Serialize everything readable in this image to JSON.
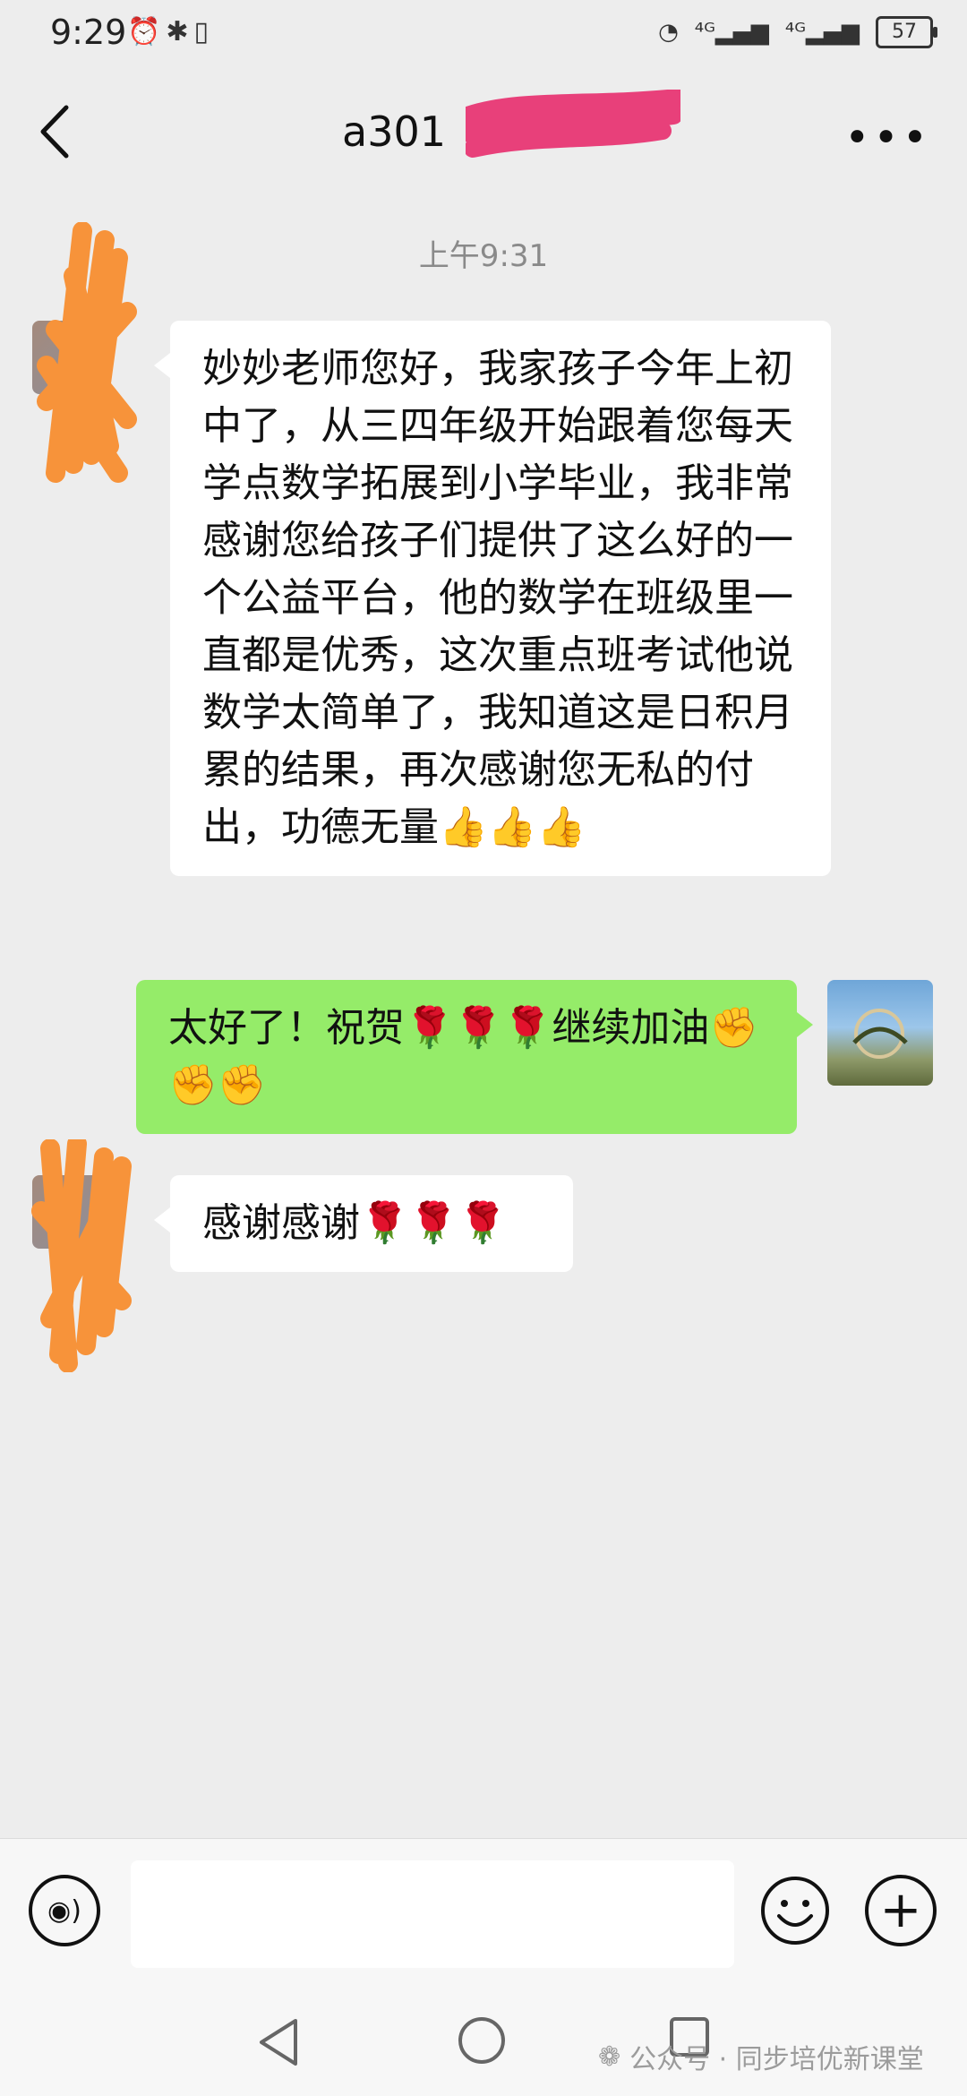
{
  "status_bar": {
    "time": "9:29",
    "left_icons": [
      "alarm-icon",
      "bluetooth-icon",
      "vibrate-icon"
    ],
    "signal_1": "⁴ᴳ",
    "signal_2": "⁴ᴳ",
    "battery": "57"
  },
  "header": {
    "title": "a301",
    "back": "back-icon",
    "more": "•••"
  },
  "timestamp": "上午9:31",
  "messages": [
    {
      "side": "in",
      "text": "妙妙老师您好，我家孩子今年上初中了，从三四年级开始跟着您每天学点数学拓展到小学毕业，我非常感谢您给孩子们提供了这么好的一个公益平台，他的数学在班级里一直都是优秀，这次重点班考试他说数学太简单了，我知道这是日积月累的结果，再次感谢您无私的付出，功德无量👍👍👍"
    },
    {
      "side": "out",
      "text": "太好了！祝贺🌹🌹🌹继续加油✊✊✊"
    },
    {
      "side": "in",
      "text": "感谢感谢🌹🌹🌹"
    }
  ],
  "input_bar": {
    "voice": "voice-icon",
    "placeholder": "",
    "emoji": "emoji-icon",
    "plus": "+"
  },
  "watermark": {
    "text": "公众号 · 同步培优新课堂"
  },
  "colors": {
    "background": "#ededed",
    "incoming_bubble": "#ffffff",
    "outgoing_bubble": "#95ec69",
    "redaction_pink": "#e8407a",
    "redaction_orange": "#f7933a"
  }
}
